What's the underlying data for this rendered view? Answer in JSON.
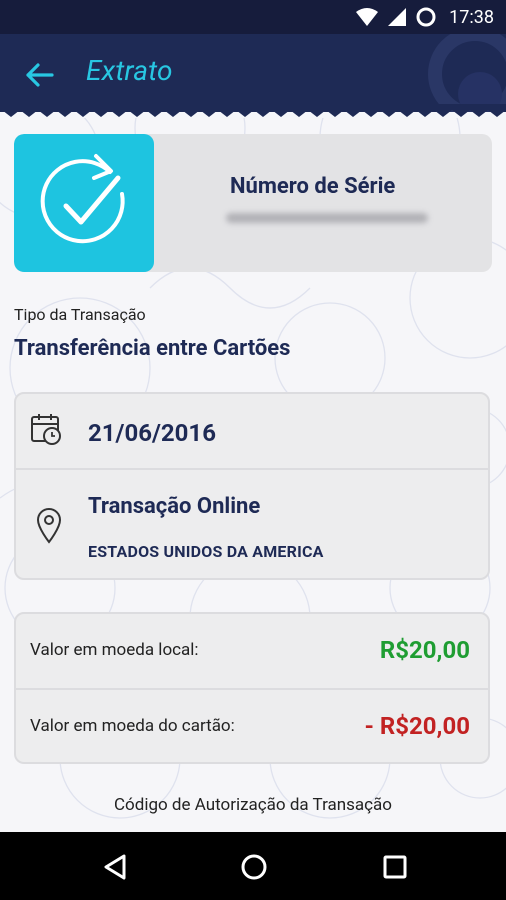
{
  "status_bar": {
    "time": "17:38",
    "icons": [
      "wifi-icon",
      "signal-icon",
      "sync-icon"
    ]
  },
  "app_bar": {
    "title": "Extrato",
    "back_icon": "arrow-back-icon"
  },
  "serial": {
    "label": "Número de Série",
    "icon": "check-refresh-icon"
  },
  "transaction_type": {
    "label": "Tipo da Transação",
    "value": "Transferência entre Cartões"
  },
  "details": {
    "date": "21/06/2016",
    "date_icon": "calendar-clock-icon",
    "location_icon": "location-pin-icon",
    "channel": "Transação Online",
    "country": "ESTADOS UNIDOS DA AMERICA"
  },
  "values": {
    "local_label": "Valor em moeda local:",
    "local_amount": "R$20,00",
    "card_label": "Valor em moeda do cartão:",
    "card_amount": "- R$20,00",
    "positive_color": "#1f9d32",
    "negative_color": "#c22222"
  },
  "authorization": {
    "label": "Código de Autorização da Transação"
  },
  "nav_bar": {
    "icons": [
      "back-triangle-icon",
      "home-circle-icon",
      "recents-square-icon"
    ]
  },
  "colors": {
    "primary": "#1e2a55",
    "accent": "#1ec4e0"
  }
}
